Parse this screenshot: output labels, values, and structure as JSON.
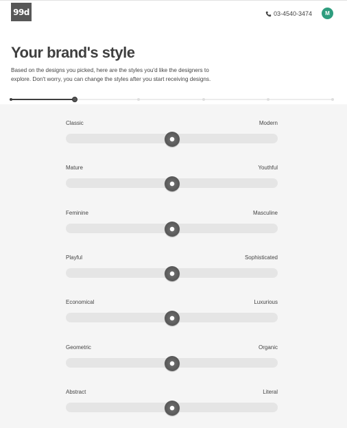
{
  "header": {
    "logo": "99d",
    "phone": "03-4540-3474",
    "avatar_initial": "M",
    "avatar_color": "#2e9d7e"
  },
  "page": {
    "title": "Your brand's style",
    "subtitle": "Based on the designs you picked, here are the styles you'd like the designers to explore. Don't worry, you can change the styles after you start receiving designs."
  },
  "progress": {
    "current_step": 2,
    "total_steps": 6
  },
  "sliders": [
    {
      "left": "Classic",
      "right": "Modern",
      "value": 0.5
    },
    {
      "left": "Mature",
      "right": "Youthful",
      "value": 0.5
    },
    {
      "left": "Feminine",
      "right": "Masculine",
      "value": 0.5
    },
    {
      "left": "Playful",
      "right": "Sophisticated",
      "value": 0.5
    },
    {
      "left": "Economical",
      "right": "Luxurious",
      "value": 0.5
    },
    {
      "left": "Geometric",
      "right": "Organic",
      "value": 0.5
    },
    {
      "left": "Abstract",
      "right": "Literal",
      "value": 0.5
    }
  ]
}
